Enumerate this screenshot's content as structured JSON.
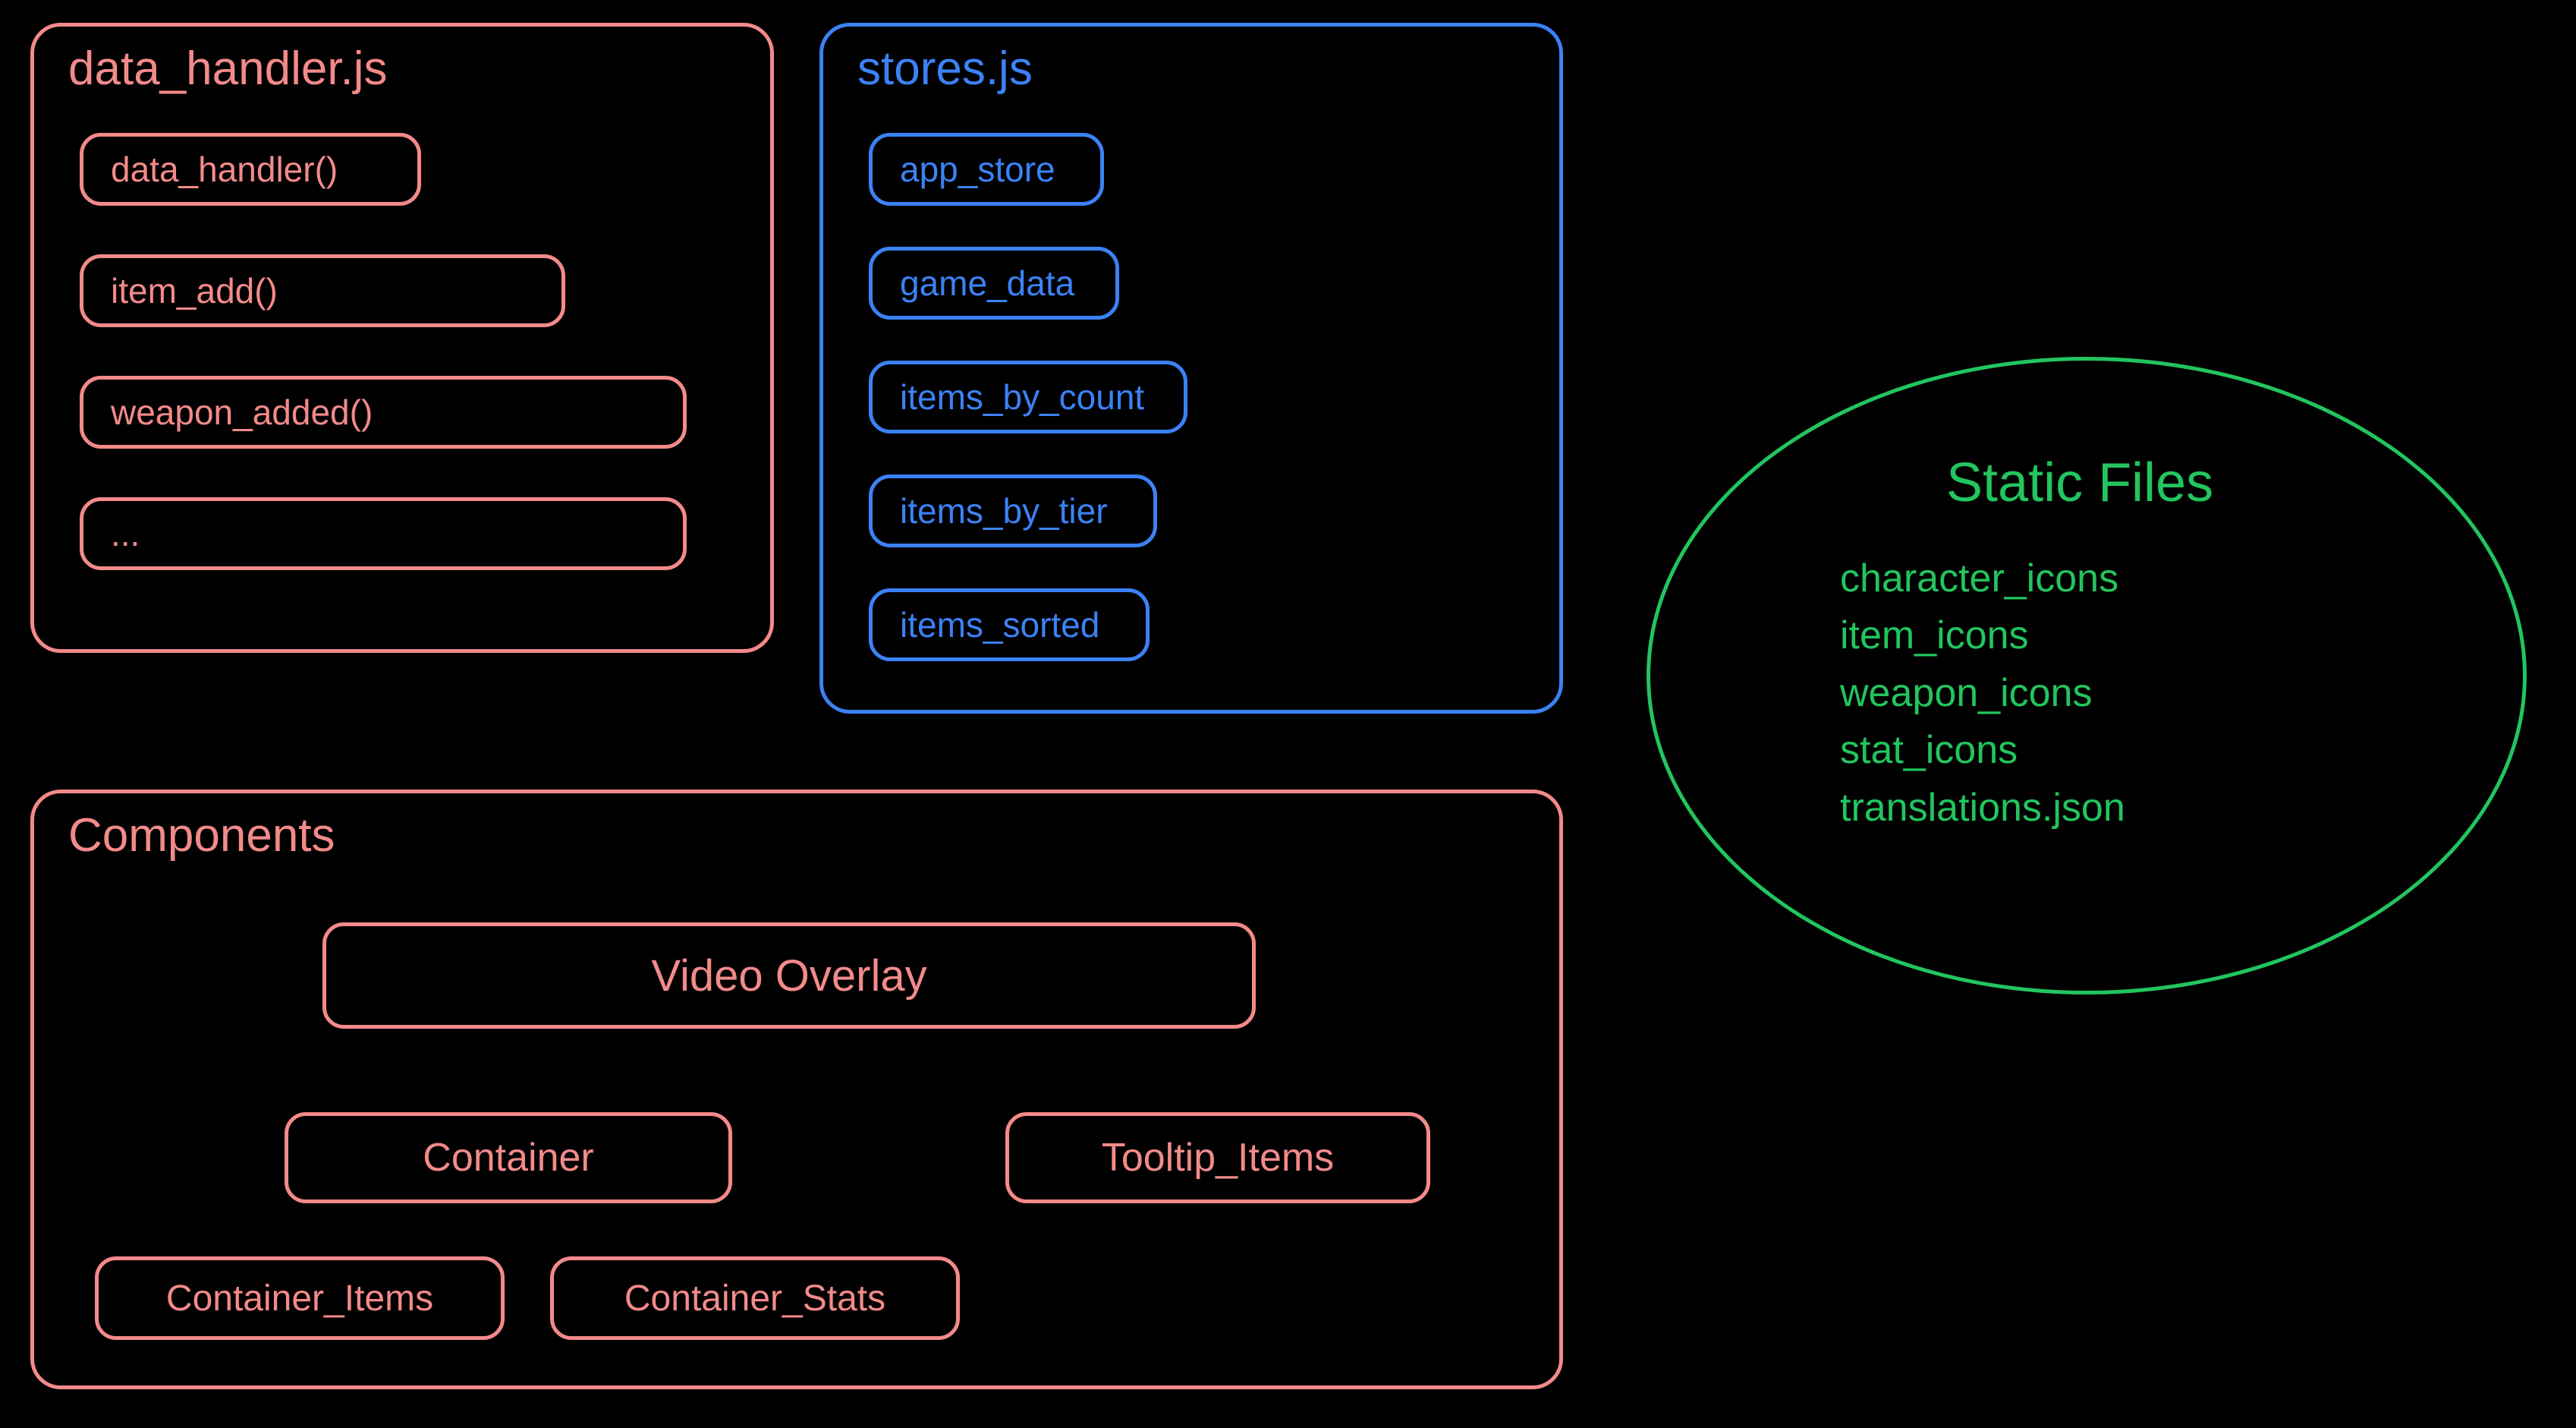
{
  "colors": {
    "pink": "#f38a8a",
    "blue": "#3b82f6",
    "green": "#22c55e",
    "bg": "#000000"
  },
  "data_handler": {
    "title": "data_handler.js",
    "items": [
      "data_handler()",
      "item_add()",
      "weapon_added()",
      "..."
    ]
  },
  "stores": {
    "title": "stores.js",
    "items": [
      "app_store",
      "game_data",
      "items_by_count",
      "items_by_tier",
      "items_sorted"
    ]
  },
  "components": {
    "title": "Components",
    "video_overlay": "Video Overlay",
    "container": "Container",
    "tooltip_items": "Tooltip_Items",
    "container_items": "Container_Items",
    "container_stats": "Container_Stats"
  },
  "static_files": {
    "title": "Static Files",
    "items": [
      "character_icons",
      "item_icons",
      "weapon_icons",
      "stat_icons",
      "translations.json"
    ]
  }
}
